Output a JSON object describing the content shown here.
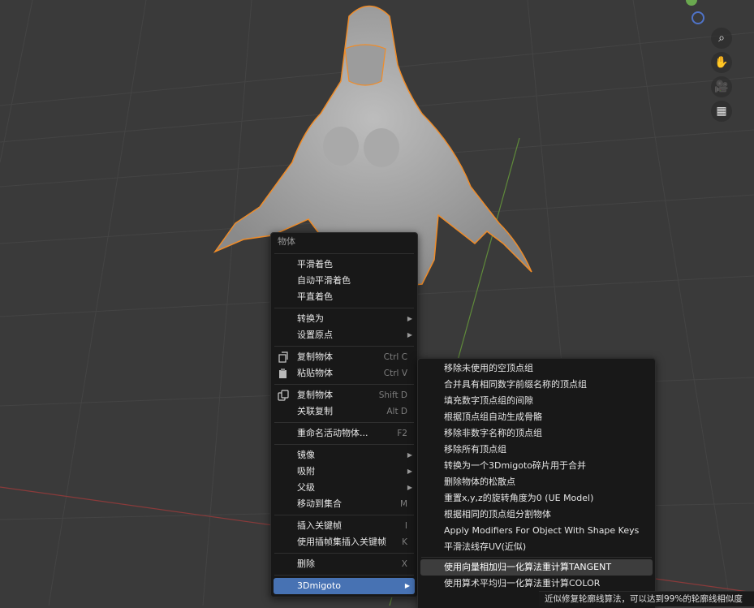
{
  "colors": {
    "viewport_bg": "#3a3a3a",
    "menu_bg": "#181818",
    "active": "#4772b3",
    "selection_outline": "#f08c28"
  },
  "gizmo": {
    "icons": [
      "axis-z-green",
      "axis-y-blue"
    ]
  },
  "nav_buttons": [
    "zoom-icon",
    "hand-pan-icon",
    "camera-icon",
    "grid-icon"
  ],
  "context_menu": {
    "title": "物体",
    "groups": [
      [
        {
          "label": "平滑着色",
          "shortcut": "",
          "submenu": false,
          "icon": ""
        },
        {
          "label": "自动平滑着色",
          "shortcut": "",
          "submenu": false,
          "icon": ""
        },
        {
          "label": "平直着色",
          "shortcut": "",
          "submenu": false,
          "icon": ""
        }
      ],
      [
        {
          "label": "转换为",
          "shortcut": "",
          "submenu": true,
          "icon": ""
        },
        {
          "label": "设置原点",
          "shortcut": "",
          "submenu": true,
          "icon": ""
        }
      ],
      [
        {
          "label": "复制物体",
          "shortcut": "Ctrl C",
          "submenu": false,
          "icon": "copy-icon"
        },
        {
          "label": "粘贴物体",
          "shortcut": "Ctrl V",
          "submenu": false,
          "icon": "paste-icon"
        }
      ],
      [
        {
          "label": "复制物体",
          "shortcut": "Shift D",
          "submenu": false,
          "icon": "duplicate-icon"
        },
        {
          "label": "关联复制",
          "shortcut": "Alt D",
          "submenu": false,
          "icon": ""
        }
      ],
      [
        {
          "label": "重命名活动物体...",
          "shortcut": "F2",
          "submenu": false,
          "icon": ""
        }
      ],
      [
        {
          "label": "镜像",
          "shortcut": "",
          "submenu": true,
          "icon": ""
        },
        {
          "label": "吸附",
          "shortcut": "",
          "submenu": true,
          "icon": ""
        },
        {
          "label": "父级",
          "shortcut": "",
          "submenu": true,
          "icon": ""
        },
        {
          "label": "移动到集合",
          "shortcut": "M",
          "submenu": false,
          "icon": ""
        }
      ],
      [
        {
          "label": "插入关键帧",
          "shortcut": "I",
          "submenu": false,
          "icon": ""
        },
        {
          "label": "使用插帧集插入关键帧",
          "shortcut": "K",
          "submenu": false,
          "icon": ""
        }
      ],
      [
        {
          "label": "删除",
          "shortcut": "X",
          "submenu": false,
          "icon": ""
        }
      ],
      [
        {
          "label": "3Dmigoto",
          "shortcut": "",
          "submenu": true,
          "icon": "",
          "active": true
        }
      ]
    ]
  },
  "submenu": {
    "items": [
      "移除未使用的空顶点组",
      "合并具有相同数字前缀名称的顶点组",
      "填充数字顶点组的间隙",
      "根据顶点组自动生成骨骼",
      "移除非数字名称的顶点组",
      "移除所有顶点组",
      "转换为一个3Dmigoto碎片用于合并",
      "删除物体的松散点",
      "重置x,y,z的旋转角度为0 (UE Model)",
      "根据相同的顶点组分割物体",
      "Apply Modifiers For Object With Shape Keys",
      "平滑法线存UV(近似)",
      "使用向量相加归一化算法重计算TANGENT",
      "使用算术平均归一化算法重计算COLOR"
    ],
    "highlighted_index": 12
  },
  "tooltip": "近似修复轮廓线算法，可以达到99%的轮廓线相似度"
}
